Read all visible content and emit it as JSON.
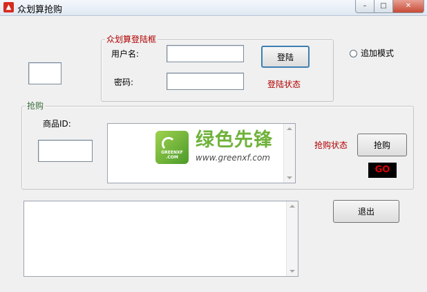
{
  "window": {
    "title": "众划算抢购",
    "minimize_glyph": "–",
    "maximize_glyph": "□",
    "close_glyph": "✕"
  },
  "login_group": {
    "legend": "众划算登陆框",
    "username_label": "用户名:",
    "username_value": "",
    "password_label": "密码:",
    "password_value": "",
    "login_button": "登陆",
    "login_status": "登陆状态"
  },
  "append_mode": {
    "label": "追加模式",
    "checked": false
  },
  "small_input_value": "",
  "purchase_group": {
    "legend": "抢购",
    "product_id_label": "商品ID:",
    "product_id_value": "",
    "list_text": "",
    "status": "抢购状态",
    "buy_button": "抢购",
    "go_indicator": "GO"
  },
  "log_text": "",
  "exit_button": "退出",
  "watermark": {
    "logo_text": "GREENXF .COM",
    "brand": "绿色先锋",
    "url": "www.greenxf.com",
    "brand_color": "#6fb23a"
  },
  "colors": {
    "status_red": "#b00000",
    "go_bg": "#000000",
    "go_fg": "#e00000"
  }
}
